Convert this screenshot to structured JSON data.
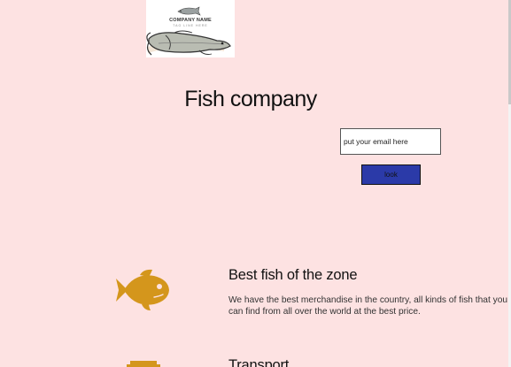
{
  "logo": {
    "company_name": "COMPANY NAME",
    "tagline": "TAG LINE HERE"
  },
  "header": {
    "title": "Fish company"
  },
  "signup": {
    "email_placeholder": "put your email here",
    "button_label": "look"
  },
  "features": [
    {
      "icon": "fish-icon",
      "title": "Best fish of the zone",
      "text": "We have the best merchandise in the country, all kinds of fish that you can find from all over the world at the best price."
    },
    {
      "icon": "truck-icon",
      "title": "Transport"
    }
  ],
  "colors": {
    "background": "#fde2e2",
    "icon_accent": "#d4961c",
    "button": "#2b3aa8"
  }
}
